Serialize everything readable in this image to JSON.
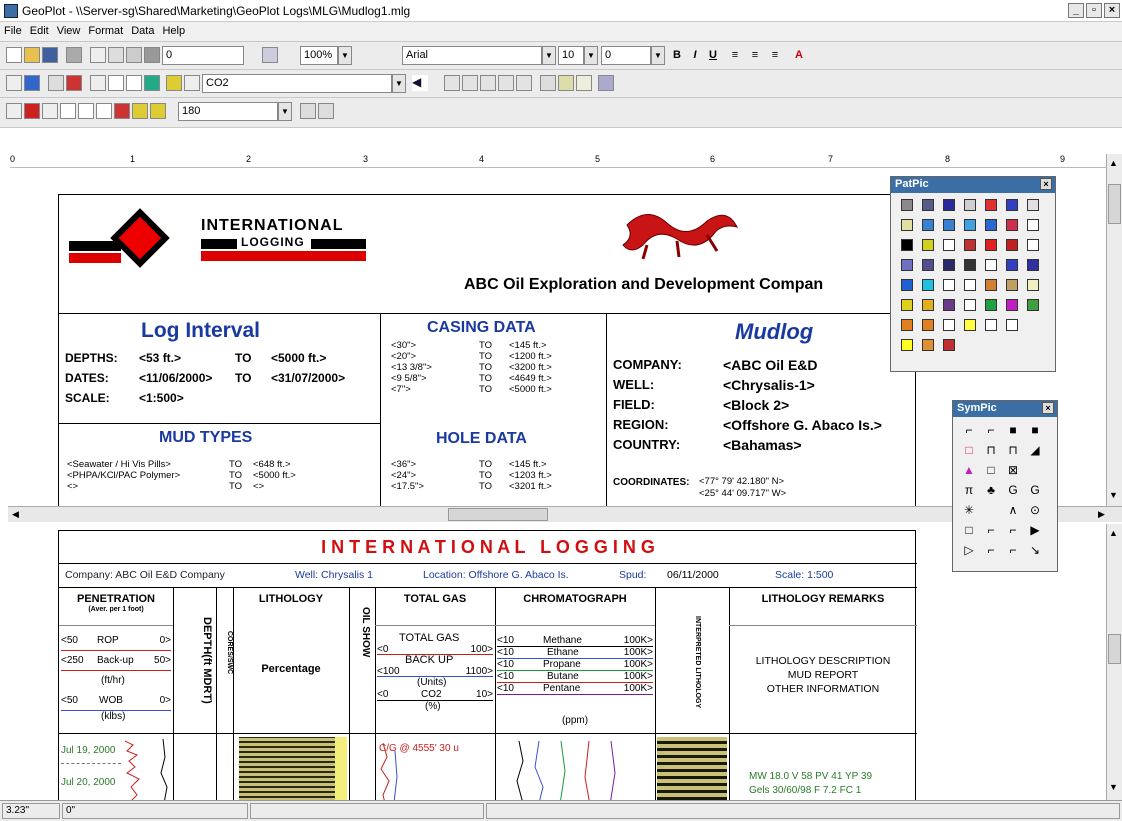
{
  "window": {
    "title": "GeoPlot - \\\\Server-sg\\Shared\\Marketing\\GeoPlot Logs\\MLG\\Mudlog1.mlg"
  },
  "menu": [
    "File",
    "Edit",
    "View",
    "Format",
    "Data",
    "Help"
  ],
  "toolbar1": {
    "rotation": "0",
    "zoom": "100%",
    "font": "Arial",
    "font_size": "10",
    "spacing": "0"
  },
  "toolbar2": {
    "curve": "CO2"
  },
  "toolbar3": {
    "angle": "180"
  },
  "ruler": [
    "0",
    "1",
    "2",
    "3",
    "4",
    "5",
    "6",
    "7",
    "8",
    "9"
  ],
  "header": {
    "logo_line1": "INTERNATIONAL",
    "logo_line2": "LOGGING",
    "company_banner": "ABC Oil Exploration and Development Compan",
    "log_interval": {
      "title": "Log Interval",
      "rows": [
        {
          "label": "DEPTHS:",
          "from": "<53 ft.>",
          "to_label": "TO",
          "to": "<5000 ft.>"
        },
        {
          "label": "DATES:",
          "from": "<11/06/2000>",
          "to_label": "TO",
          "to": "<31/07/2000>"
        },
        {
          "label": "SCALE:",
          "from": "<1:500>",
          "to_label": "",
          "to": ""
        }
      ]
    },
    "casing_data": {
      "title": "CASING DATA",
      "rows": [
        {
          "size": "<30\">",
          "to": "TO",
          "depth": "<145 ft.>"
        },
        {
          "size": "<20\">",
          "to": "TO",
          "depth": "<1200 ft.>"
        },
        {
          "size": "<13 3/8\">",
          "to": "TO",
          "depth": "<3200 ft.>"
        },
        {
          "size": "<9 5/8\">",
          "to": "TO",
          "depth": "<4649 ft.>"
        },
        {
          "size": "<7\">",
          "to": "TO",
          "depth": "<5000 ft.>"
        }
      ]
    },
    "mud_types": {
      "title": "MUD TYPES",
      "rows": [
        {
          "type": "<Seawater / Hi Vis Pills>",
          "to": "TO",
          "depth": "<648 ft.>"
        },
        {
          "type": "<PHPA/KCl/PAC Polymer>",
          "to": "TO",
          "depth": "<5000 ft.>"
        },
        {
          "type": "<>",
          "to": "TO",
          "depth": "<>"
        }
      ]
    },
    "hole_data": {
      "title": "HOLE DATA",
      "rows": [
        {
          "size": "<36\">",
          "to": "TO",
          "depth": "<145 ft.>"
        },
        {
          "size": "<24\">",
          "to": "TO",
          "depth": "<1203 ft.>"
        },
        {
          "size": "<17.5\">",
          "to": "TO",
          "depth": "<3201 ft.>"
        }
      ]
    },
    "mudlog": {
      "title": "Mudlog",
      "rows": [
        {
          "label": "COMPANY:",
          "value": "<ABC Oil E&D"
        },
        {
          "label": "WELL:",
          "value": "<Chrysalis-1>"
        },
        {
          "label": "FIELD:",
          "value": "<Block 2>"
        },
        {
          "label": "REGION:",
          "value": "<Offshore G. Abaco Is.>"
        },
        {
          "label": "COUNTRY:",
          "value": "<Bahamas>"
        }
      ],
      "coord_label": "COORDINATES:",
      "coord_n": "<77° 79' 42.180\" N>",
      "coord_w": "<25° 44' 09.717\" W>"
    }
  },
  "log": {
    "banner": "I N T E R N A T I O N A L   L O G G I N G",
    "info": {
      "company": "Company: ABC Oil E&D Company",
      "well": "Well: Chrysalis 1",
      "location": "Location: Offshore G. Abaco Is.",
      "spud_label": "Spud:",
      "spud": "06/11/2000",
      "scale": "Scale: 1:500"
    },
    "columns": {
      "penetration": "PENETRATION",
      "penetration_sub": "(Aver. per 1 foot)",
      "depth": "DEPTH(ft MDRT)",
      "cores": "CORES/SWC",
      "lithology": "LITHOLOGY",
      "oilshow": "OIL SHOW",
      "totalgas": "TOTAL GAS",
      "chromatograph": "CHROMATOGRAPH",
      "interp": "INTERPRETED LITHOLOGY",
      "remarks": "LITHOLOGY REMARKS"
    },
    "pen_rows": [
      {
        "min": "<50",
        "label": "ROP",
        "max": "0>"
      },
      {
        "min": "<250",
        "label": "Back-up",
        "max": "50>"
      },
      {
        "min": "",
        "label": "(ft/hr)",
        "max": ""
      },
      {
        "min": "<50",
        "label": "WOB",
        "max": "0>"
      },
      {
        "min": "",
        "label": "(klbs)",
        "max": ""
      }
    ],
    "lith_percent": "Percentage",
    "gas_rows": [
      {
        "min": "<0",
        "label": "TOTAL GAS",
        "max": "100>"
      },
      {
        "min": "<100",
        "label": "BACK UP",
        "max": "1100>"
      },
      {
        "min": "",
        "label": "(Units)",
        "max": ""
      },
      {
        "min": "<0",
        "label": "CO2",
        "max": "10>"
      },
      {
        "min": "",
        "label": "(%)",
        "max": ""
      }
    ],
    "chrom_rows": [
      {
        "min": "<10",
        "label": "Methane",
        "max": "100K>",
        "color": "#000000"
      },
      {
        "min": "<10",
        "label": "Ethane",
        "max": "100K>",
        "color": "#3a4fd0"
      },
      {
        "min": "<10",
        "label": "Propane",
        "max": "100K>",
        "color": "#1a9a3a"
      },
      {
        "min": "<10",
        "label": "Butane",
        "max": "100K>",
        "color": "#c81e1e"
      },
      {
        "min": "<10",
        "label": "Pentane",
        "max": "100K>",
        "color": "#7a1aa0"
      }
    ],
    "chrom_unit": "(ppm)",
    "remarks_lines": [
      "LITHOLOGY DESCRIPTION",
      "MUD REPORT",
      "OTHER INFORMATION"
    ],
    "dates": [
      "Jul 19, 2000",
      "Jul 20, 2000"
    ],
    "gas_note": "C/G @ 4555' 30 u",
    "remark_row1": "MW 18.0 V 58 PV 41 YP 39",
    "remark_row2": "Gels 30/60/98 F 7.2 FC 1"
  },
  "patpic": {
    "title": "PatPic"
  },
  "sympic": {
    "title": "SymPic"
  },
  "status": {
    "pos": "3.23\"",
    "depth": "0\""
  }
}
